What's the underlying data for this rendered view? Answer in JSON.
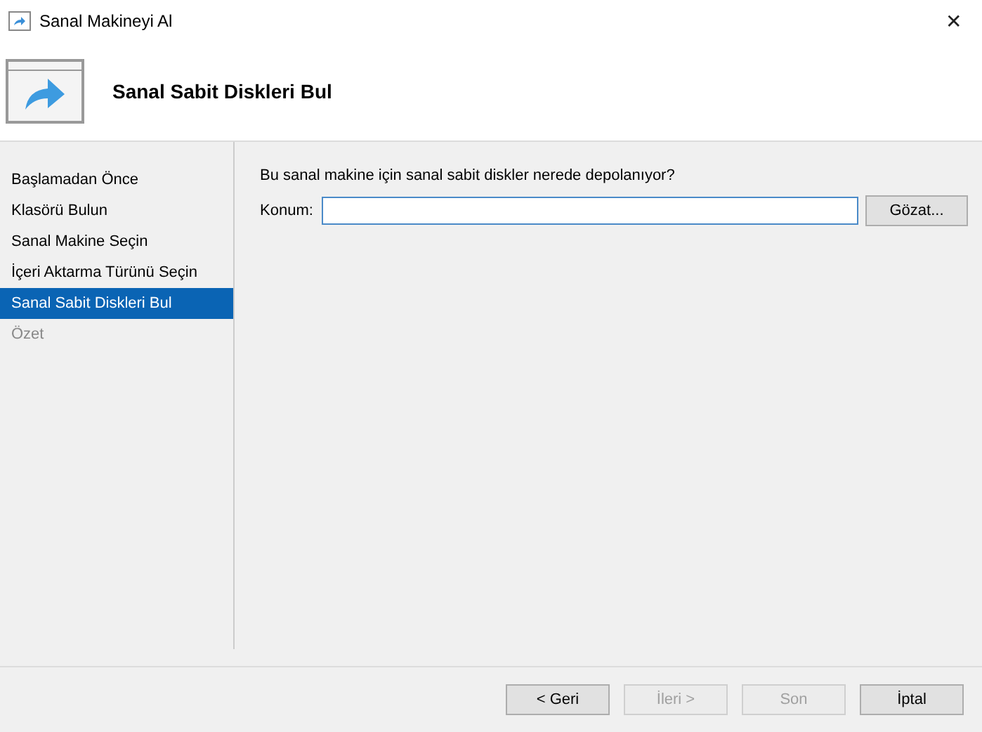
{
  "window": {
    "title": "Sanal Makineyi Al",
    "close": "✕"
  },
  "header": {
    "title": "Sanal Sabit Diskleri Bul"
  },
  "steps": [
    {
      "label": "Başlamadan Önce",
      "selected": false,
      "disabled": false
    },
    {
      "label": "Klasörü Bulun",
      "selected": false,
      "disabled": false
    },
    {
      "label": "Sanal Makine Seçin",
      "selected": false,
      "disabled": false
    },
    {
      "label": "İçeri Aktarma Türünü Seçin",
      "selected": false,
      "disabled": false
    },
    {
      "label": "Sanal Sabit Diskleri Bul",
      "selected": true,
      "disabled": false
    },
    {
      "label": "Özet",
      "selected": false,
      "disabled": true
    }
  ],
  "content": {
    "question": "Bu sanal makine için sanal sabit diskler nerede depolanıyor?",
    "location_label": "Konum:",
    "browse": "Gözat..."
  },
  "buttons": [
    {
      "label": "< Geri",
      "disabled": false
    },
    {
      "label": "İleri >",
      "disabled": true
    },
    {
      "label": "Son",
      "disabled": true
    },
    {
      "label": "İptal",
      "disabled": false
    }
  ]
}
